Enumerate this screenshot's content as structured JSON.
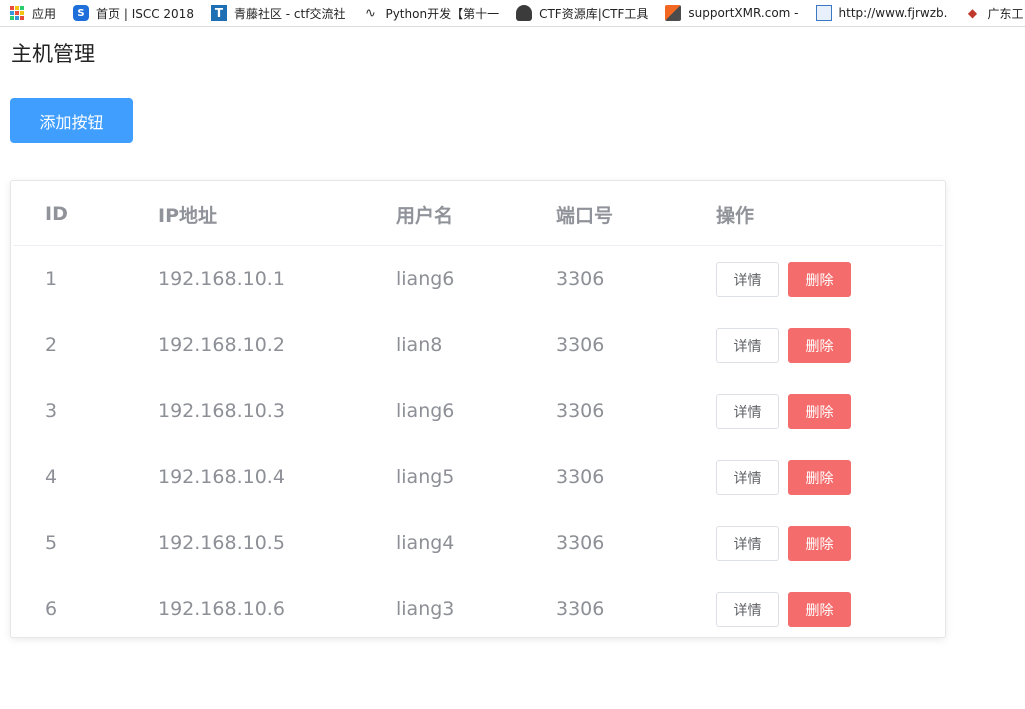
{
  "bookmarks": [
    {
      "label": "应用",
      "icon": "apps-grid-icon"
    },
    {
      "label": "首页 | ISCC 2018",
      "icon": "iscc-icon"
    },
    {
      "label": "青藤社区 - ctf交流社",
      "icon": "qingteng-icon"
    },
    {
      "label": "Python开发【第十一",
      "icon": "python-icon"
    },
    {
      "label": "CTF资源库|CTF工具",
      "icon": "ctf-hacker-icon"
    },
    {
      "label": "supportXMR.com -",
      "icon": "xmr-icon"
    },
    {
      "label": "http://www.fjrwzb.",
      "icon": "fjrwzb-icon"
    },
    {
      "label": "广东工",
      "icon": "guangdong-icon"
    }
  ],
  "page": {
    "title": "主机管理"
  },
  "toolbar": {
    "add_label": "添加按钮"
  },
  "table": {
    "headers": {
      "id": "ID",
      "ip": "IP地址",
      "user": "用户名",
      "port": "端口号",
      "op": "操作"
    },
    "rows": [
      {
        "id": "1",
        "ip": "192.168.10.1",
        "user": "liang6",
        "port": "3306"
      },
      {
        "id": "2",
        "ip": "192.168.10.2",
        "user": "lian8",
        "port": "3306"
      },
      {
        "id": "3",
        "ip": "192.168.10.3",
        "user": "liang6",
        "port": "3306"
      },
      {
        "id": "4",
        "ip": "192.168.10.4",
        "user": "liang5",
        "port": "3306"
      },
      {
        "id": "5",
        "ip": "192.168.10.5",
        "user": "liang4",
        "port": "3306"
      },
      {
        "id": "6",
        "ip": "192.168.10.6",
        "user": "liang3",
        "port": "3306"
      }
    ],
    "detail_label": "详情",
    "delete_label": "删除"
  },
  "colors": {
    "primary": "#409eff",
    "danger": "#f56c6c"
  }
}
